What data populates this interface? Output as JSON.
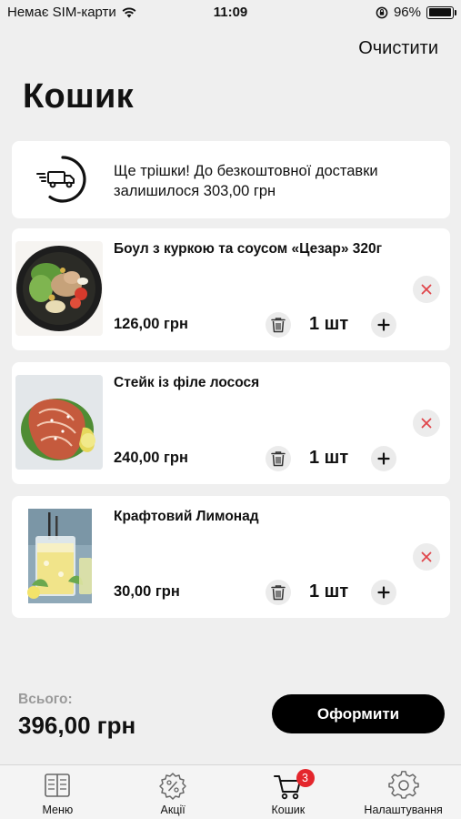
{
  "status_bar": {
    "carrier": "Немає SIM-карти",
    "time": "11:09",
    "battery": "96%",
    "battery_level": 0.96,
    "icons": [
      "wifi-icon",
      "orientation-lock-icon",
      "battery-icon"
    ]
  },
  "header": {
    "clear_label": "Очистити",
    "title": "Кошик"
  },
  "delivery_notice": {
    "icon": "delivery-truck-icon",
    "text": "Ще трішки! До безкоштовної доставки залишилося 303,00 грн"
  },
  "cart": {
    "items": [
      {
        "name": "Боул з куркою та соусом «Цезар» 320г",
        "price": "126,00 грн",
        "quantity": "1 шт"
      },
      {
        "name": "Стейк із філе лосося",
        "price": "240,00 грн",
        "quantity": "1 шт"
      },
      {
        "name": "Крафтовий Лимонад",
        "price": "30,00 грн",
        "quantity": "1 шт"
      }
    ]
  },
  "summary": {
    "total_label": "Всього:",
    "total_value": "396,00 грн",
    "checkout_label": "Оформити"
  },
  "tab_bar": {
    "tabs": [
      {
        "label": "Меню",
        "icon": "menu-book-icon"
      },
      {
        "label": "Акції",
        "icon": "discount-badge-icon"
      },
      {
        "label": "Кошик",
        "icon": "cart-icon",
        "badge": "3",
        "active": true
      },
      {
        "label": "Налаштування",
        "icon": "settings-gear-icon"
      }
    ]
  },
  "colors": {
    "background": "#efefef",
    "card": "#ffffff",
    "accent": "#000000",
    "badge": "#e4262c",
    "remove_x": "#e0454a"
  }
}
